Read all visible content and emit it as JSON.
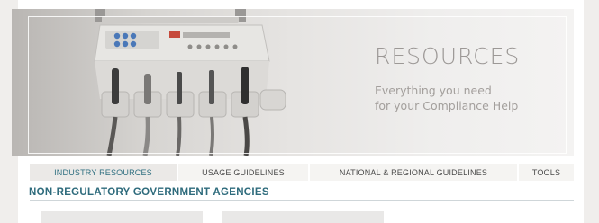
{
  "hero": {
    "title": "RESOURCES",
    "subtitle_line1": "Everything you need",
    "subtitle_line2": "for your Compliance Help",
    "image_icon": "dental-unit-image"
  },
  "tabs": [
    {
      "label": "INDUSTRY RESOURCES",
      "active": true
    },
    {
      "label": "USAGE GUIDELINES",
      "active": false
    },
    {
      "label": "NATIONAL & REGIONAL GUIDELINES",
      "active": false
    },
    {
      "label": "TOOLS",
      "active": false
    }
  ],
  "section": {
    "title": "NON-REGULATORY GOVERNMENT AGENCIES"
  },
  "colors": {
    "accent": "#2e6b7c",
    "tab_bg": "#f5f4f2",
    "tab_active_bg": "#ebe9e7"
  }
}
